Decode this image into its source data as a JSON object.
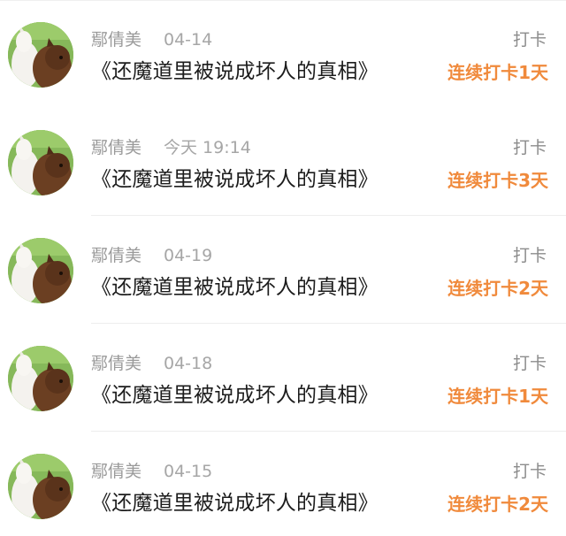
{
  "feed": {
    "items": [
      {
        "user_name": "鄢倩美",
        "time": "今天 19:14",
        "title": "《还魔道里被说成坏人的真相》",
        "action_label": "打卡",
        "streak_label": "连续打卡3天",
        "avatar_icon": "alpaca-avatar"
      },
      {
        "user_name": "鄢倩美",
        "time": "04-19",
        "title": "《还魔道里被说成坏人的真相》",
        "action_label": "打卡",
        "streak_label": "连续打卡2天",
        "avatar_icon": "alpaca-avatar"
      },
      {
        "user_name": "鄢倩美",
        "time": "04-18",
        "title": "《还魔道里被说成坏人的真相》",
        "action_label": "打卡",
        "streak_label": "连续打卡1天",
        "avatar_icon": "alpaca-avatar"
      },
      {
        "user_name": "鄢倩美",
        "time": "04-15",
        "title": "《还魔道里被说成坏人的真相》",
        "action_label": "打卡",
        "streak_label": "连续打卡2天",
        "avatar_icon": "alpaca-avatar"
      },
      {
        "user_name": "鄢倩美",
        "time": "04-14",
        "title": "《还魔道里被说成坏人的真相》",
        "action_label": "打卡",
        "streak_label": "连续打卡1天",
        "avatar_icon": "alpaca-avatar"
      }
    ]
  },
  "colors": {
    "streak": "#f08a3c",
    "name": "#9a9a9a",
    "title": "#1c1c1c"
  }
}
